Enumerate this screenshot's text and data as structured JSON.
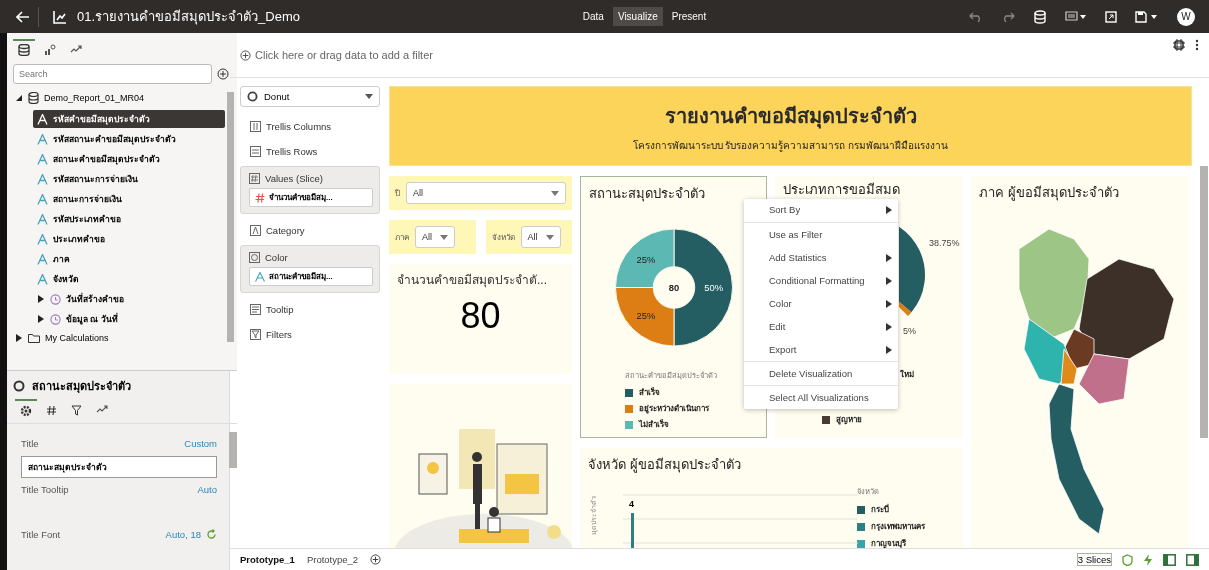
{
  "topbar": {
    "title": "01.รายงานคำขอมีสมุดประจำตัว_Demo",
    "modes": [
      {
        "label": "Data",
        "selected": false
      },
      {
        "label": "Visualize",
        "selected": true
      },
      {
        "label": "Present",
        "selected": false
      }
    ],
    "avatar": "W"
  },
  "data_panel": {
    "tabs": [
      {
        "kind": "data",
        "selected": true
      },
      {
        "kind": "visualizations",
        "selected": false
      },
      {
        "kind": "analytics",
        "selected": false
      }
    ],
    "search": {
      "placeholder": "Search"
    },
    "tree": [
      {
        "label": "Demo_Report_01_MR04",
        "kind": "dataset",
        "expanded": true,
        "children": [
          {
            "label": "รหัสคำขอมีสมุดประจำตัว",
            "kind": "attribute",
            "selected": true
          },
          {
            "label": "รหัสสถานะคำขอมีสมุดประจำตัว",
            "kind": "attribute",
            "selected": false
          },
          {
            "label": "สถานะคำขอมีสมุดประจำตัว",
            "kind": "attribute",
            "selected": false
          },
          {
            "label": "รหัสสถานะการจ่ายเงิน",
            "kind": "attribute",
            "selected": false
          },
          {
            "label": "สถานะการจ่ายเงิน",
            "kind": "attribute",
            "selected": false
          },
          {
            "label": "รหัสประเภทคำขอ",
            "kind": "attribute",
            "selected": false
          },
          {
            "label": "ประเภทคำขอ",
            "kind": "attribute",
            "selected": false
          },
          {
            "label": "ภาค",
            "kind": "attribute",
            "selected": false
          },
          {
            "label": "จังหวัด",
            "kind": "attribute",
            "selected": false
          },
          {
            "label": "วันที่สร้างคำขอ",
            "kind": "time",
            "expanded": false,
            "selected": false
          },
          {
            "label": "ข้อมูล ณ วันที่",
            "kind": "time",
            "expanded": false,
            "selected": false
          }
        ]
      },
      {
        "label": "My Calculations",
        "kind": "folder",
        "expanded": false
      }
    ]
  },
  "properties": {
    "title": "สถานะสมุดประจำตัว",
    "tabs": [
      {
        "kind": "general",
        "selected": true
      },
      {
        "kind": "values",
        "selected": false
      },
      {
        "kind": "filters",
        "selected": false
      },
      {
        "kind": "analytics",
        "selected": false
      }
    ],
    "rows": [
      {
        "label": "Title",
        "value": "Custom",
        "field": "สถานะสมุดประจำตัว"
      },
      {
        "label": "Title Tooltip",
        "value": "Auto"
      },
      {
        "label": "Title Font",
        "value": "Auto, 18"
      }
    ]
  },
  "filter_bar": {
    "placeholder": "Click here or drag data to add a filter"
  },
  "grammar": [
    {
      "kind": "dropdown",
      "label": "Donut"
    },
    {
      "kind": "target",
      "label": "Trellis Columns"
    },
    {
      "kind": "target",
      "label": "Trellis Rows"
    },
    {
      "kind": "box",
      "label": "Values (Slice)",
      "chip": {
        "kind": "measure",
        "label": "จำนวนคำขอมีสมุ..."
      }
    },
    {
      "kind": "target",
      "label": "Category"
    },
    {
      "kind": "box",
      "label": "Color",
      "chip": {
        "kind": "attribute",
        "label": "สถานะคำขอมีสมุ..."
      }
    },
    {
      "kind": "target",
      "label": "Tooltip"
    },
    {
      "kind": "target",
      "label": "Filters"
    }
  ],
  "banner": {
    "title": "รายงานคำขอมีสมุดประจำตัว",
    "subtitle": "โครงการพัฒนาระบบ รับรองความรู้ความสามารถ กรมพัฒนาฝีมือแรงงาน"
  },
  "filters": [
    {
      "label": "ปี",
      "value": "All"
    },
    {
      "label": "ภาค",
      "value": "All"
    },
    {
      "label": "จังหวัด",
      "value": "All"
    }
  ],
  "kpi": {
    "title": "จำนวนคำขอมีสมุดประจำตั...",
    "value": "80"
  },
  "status_card": {
    "title": "สถานะสมุดประจำตัว",
    "center": "80",
    "chart_data": {
      "type": "donut",
      "categories": [
        "สำเร็จ",
        "อยู่ระหว่างดำเนินการ",
        "ไม่สำเร็จ"
      ],
      "series": [
        {
          "name": "สถานะคำขอมีสมุดประจำตัว",
          "values": [
            50,
            25,
            25
          ]
        }
      ],
      "value_labels": [
        "50%",
        "25%",
        "25%"
      ],
      "colors": [
        "#245e63",
        "#dd7e14",
        "#5cb8b2"
      ]
    }
  },
  "type_card": {
    "title": "ประเภทการขอมีสมด",
    "labels": [
      "38.75%",
      "5%"
    ],
    "legend": [
      {
        "label": "ใหม่"
      },
      {
        "label": "สูญหาย",
        "color": "#4a3b31"
      }
    ]
  },
  "map_card": {
    "title": "ภาค ผู้ขอมีสมุดประจำตัว"
  },
  "province_card": {
    "title": "จังหวัด ผู้ขอมีสมุดประจำตัว",
    "axis_label": "มุดประจำตัว",
    "bar_label": "4",
    "legend_title": "จังหวัด",
    "legend": [
      {
        "label": "กระบี่",
        "color": "#245e63"
      },
      {
        "label": "กรุงเทพมหานคร",
        "color": "#2c7f82"
      },
      {
        "label": "กาญจนบุรี",
        "color": "#3aa3a6"
      }
    ]
  },
  "context_menu": [
    [
      {
        "label": "Sort By",
        "submenu": true
      }
    ],
    [
      {
        "label": "Use as Filter",
        "submenu": false
      },
      {
        "label": "Add Statistics",
        "submenu": true
      },
      {
        "label": "Conditional Formatting",
        "submenu": true
      },
      {
        "label": "Color",
        "submenu": true
      },
      {
        "label": "Edit",
        "submenu": true
      },
      {
        "label": "Export",
        "submenu": true
      }
    ],
    [
      {
        "label": "Delete Visualization",
        "submenu": false
      }
    ],
    [
      {
        "label": "Select All Visualizations",
        "submenu": false
      }
    ]
  ],
  "bottom_bar": {
    "tabs": [
      {
        "label": "Prototype_1",
        "selected": true
      },
      {
        "label": "Prototype_2",
        "selected": false
      }
    ],
    "status": "3 Slices"
  }
}
